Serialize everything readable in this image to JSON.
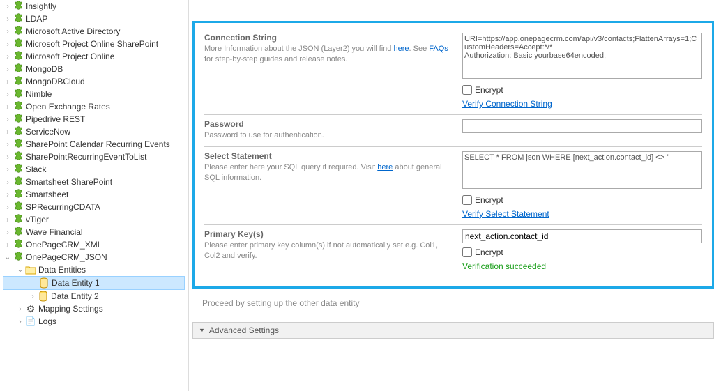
{
  "tree": {
    "root_items": [
      "Insightly",
      "LDAP",
      "Microsoft Active Directory",
      "Microsoft Project Online SharePoint",
      "Microsoft Project Online",
      "MongoDB",
      "MongoDBCloud",
      "Nimble",
      "Open Exchange Rates",
      "Pipedrive REST",
      "ServiceNow",
      "SharePoint Calendar Recurring Events",
      "SharePointRecurringEventToList",
      "Slack",
      "Smartsheet SharePoint",
      "Smartsheet",
      "SPRecurringCDATA",
      "vTiger",
      "Wave Financial",
      "OnePageCRM_XML",
      "OnePageCRM_JSON"
    ],
    "data_entities_label": "Data Entities",
    "entity1": "Data Entity 1",
    "entity2": "Data Entity 2",
    "mapping_settings": "Mapping Settings",
    "logs": "Logs"
  },
  "form": {
    "conn": {
      "title": "Connection String",
      "desc_pre": "More Information about the JSON (Layer2) you will find ",
      "here1": "here",
      "desc_mid": ". See ",
      "faqs": "FAQs",
      "desc_post": " for step-by-step guides and release notes.",
      "value": "URI=https://app.onepagecrm.com/api/v3/contacts;FlattenArrays=1;CustomHeaders=Accept:*/*\nAuthorization: Basic yourbase64encoded;",
      "encrypt": "Encrypt",
      "verify": "Verify Connection String"
    },
    "password": {
      "title": "Password",
      "desc": "Password to use for authentication.",
      "value": ""
    },
    "select": {
      "title": "Select Statement",
      "desc_pre": "Please enter here your SQL query if required. Visit ",
      "here": "here",
      "desc_post": " about general SQL information.",
      "value": "SELECT * FROM json WHERE [next_action.contact_id] <> ''",
      "encrypt": "Encrypt",
      "verify": "Verify Select Statement"
    },
    "pkey": {
      "title": "Primary Key(s)",
      "desc": "Please enter primary key column(s) if not automatically set e.g. Col1, Col2 and verify.",
      "value": "next_action.contact_id",
      "encrypt": "Encrypt",
      "success": "Verification succeeded"
    },
    "proceed": "Proceed by setting up the other data entity",
    "advanced": "Advanced Settings"
  }
}
